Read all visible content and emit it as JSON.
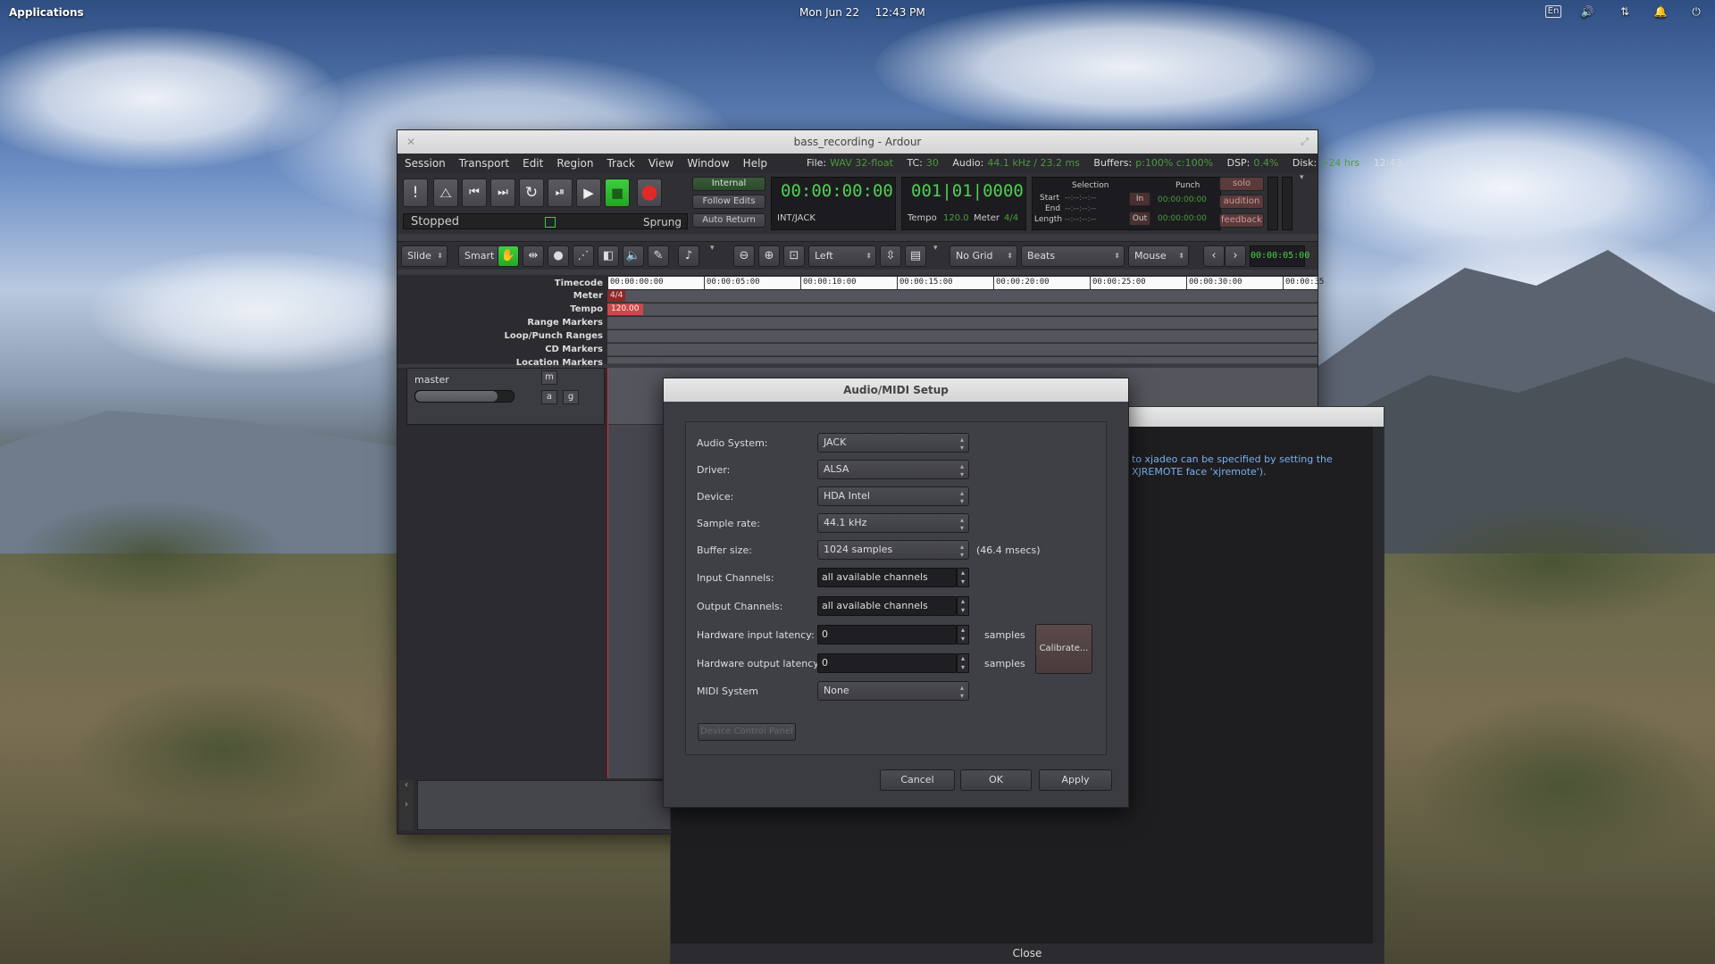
{
  "panel": {
    "applications": "Applications",
    "date": "Mon Jun 22",
    "time": "12:43 PM",
    "tray_lang": "En"
  },
  "ardour": {
    "title": "bass_recording - Ardour",
    "menu": [
      "Session",
      "Transport",
      "Edit",
      "Region",
      "Track",
      "View",
      "Window",
      "Help"
    ],
    "status": {
      "file_label": "File:",
      "file_val": "WAV 32-float",
      "tc_label": "TC:",
      "tc_val": "30",
      "audio_label": "Audio:",
      "audio_val": "44.1 kHz / 23.2 ms",
      "buffers_label": "Buffers:",
      "buffers_val": "p:100% c:100%",
      "dsp_label": "DSP:",
      "dsp_val": "0.4%",
      "disk_label": "Disk:",
      "disk_val": ">24 hrs",
      "time": "12:43"
    },
    "transport": {
      "stopped": "Stopped",
      "sprung": "Sprung",
      "internal": "Internal",
      "follow_edits": "Follow Edits",
      "auto_return": "Auto Return",
      "timecode": "00:00:00:00",
      "bbt": "001|01|0000",
      "int_jack": "INT/JACK",
      "tempo_label": "Tempo",
      "tempo_val": "120.0",
      "meter_label": "Meter",
      "meter_val": "4/4",
      "selection": "Selection",
      "punch": "Punch",
      "start": "Start",
      "end": "End",
      "length": "Length",
      "dashes": "--:--:--:--",
      "in": "In",
      "out": "Out",
      "punch_in": "00:00:00:00",
      "punch_out": "00:00:00:00",
      "solo": "solo",
      "audition": "audition",
      "feedback": "feedback"
    },
    "toolbar": {
      "slide": "Slide",
      "smart": "Smart",
      "left": "Left",
      "no_grid": "No Grid",
      "beats": "Beats",
      "mouse": "Mouse",
      "nudge_clock": "00:00:05:00"
    },
    "rulers": {
      "labels": [
        "Timecode",
        "Meter",
        "Tempo",
        "Range Markers",
        "Loop/Punch Ranges",
        "CD Markers",
        "Location Markers"
      ],
      "ticks": [
        "00:00:00:00",
        "00:00:05:00",
        "00:00:10:00",
        "00:00:15:00",
        "00:00:20:00",
        "00:00:25:00",
        "00:00:30:00",
        "00:00:35"
      ],
      "meter_marker": "4/4",
      "tempo_marker": "120.00"
    },
    "master": {
      "name": "master",
      "m": "m",
      "a": "a",
      "g": "g"
    }
  },
  "log": {
    "text": "to xjadeo can be specified by setting the XJREMOTE face 'xjremote').",
    "close": "Close"
  },
  "dialog": {
    "title": "Audio/MIDI Setup",
    "audio_system_label": "Audio System:",
    "audio_system": "JACK",
    "driver_label": "Driver:",
    "driver": "ALSA",
    "device_label": "Device:",
    "device": "HDA Intel",
    "sample_rate_label": "Sample rate:",
    "sample_rate": "44.1 kHz",
    "buffer_size_label": "Buffer size:",
    "buffer_size": "1024 samples",
    "buffer_ms": "(46.4 msecs)",
    "input_channels_label": "Input Channels:",
    "input_channels": "all available channels",
    "output_channels_label": "Output Channels:",
    "output_channels": "all available channels",
    "hw_in_label": "Hardware input latency:",
    "hw_in": "0",
    "hw_in_unit": "samples",
    "hw_out_label": "Hardware output latency:",
    "hw_out": "0",
    "hw_out_unit": "samples",
    "calibrate": "Calibrate...",
    "midi_label": "MIDI System",
    "midi": "None",
    "device_control_panel": "Device Control Panel",
    "cancel": "Cancel",
    "ok": "OK",
    "apply": "Apply"
  }
}
